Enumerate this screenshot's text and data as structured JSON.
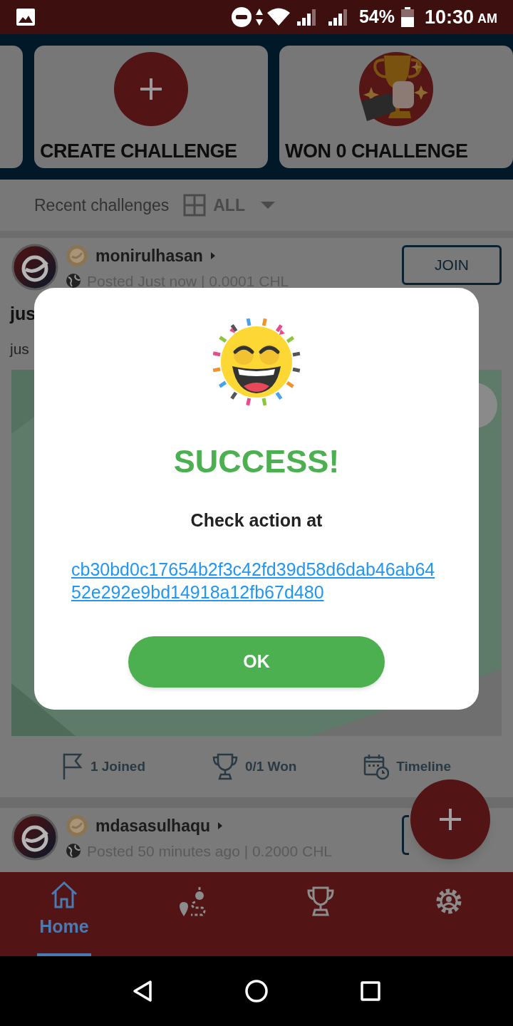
{
  "status_bar": {
    "battery": "54%",
    "time": "10:30",
    "time_suffix": "AM"
  },
  "header_cards": [
    {
      "kind": "create",
      "label": "CREATE CHALLENGE"
    },
    {
      "kind": "won",
      "label": "WON 0 CHALLENGE"
    }
  ],
  "filter": {
    "label": "Recent challenges",
    "value": "ALL"
  },
  "posts": [
    {
      "username": "monirulhasan",
      "meta": "Posted Just now | 0.0001 CHL",
      "title": "jus",
      "body": "jus",
      "join": "JOIN",
      "stats": [
        {
          "kind": "joined",
          "label": "1 Joined"
        },
        {
          "kind": "won",
          "label": "0/1 Won"
        },
        {
          "kind": "timeline",
          "label": "Timeline"
        }
      ]
    },
    {
      "username": "mdasasulhaqu",
      "meta": "Posted 50 minutes ago | 0.2000 CHL"
    }
  ],
  "bottom_nav": [
    {
      "kind": "home",
      "label": "Home",
      "selected": true
    },
    {
      "kind": "route",
      "selected": false
    },
    {
      "kind": "trophy",
      "selected": false
    },
    {
      "kind": "settings",
      "selected": false
    }
  ],
  "dialog": {
    "title": "SUCCESS!",
    "message": "Check action at",
    "link": "cb30bd0c17654b2f3c42fd39d58d6dab46ab6452e292e9bd14918a12fb67d480",
    "button": "OK"
  }
}
